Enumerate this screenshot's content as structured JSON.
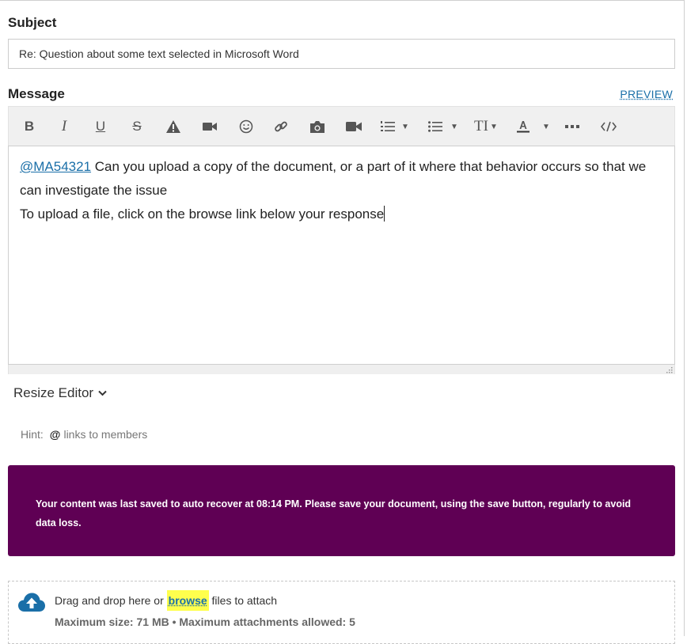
{
  "subject": {
    "label": "Subject",
    "value": "Re: Question about some text selected in Microsoft Word"
  },
  "message": {
    "label": "Message",
    "preview_label": "PREVIEW"
  },
  "toolbar": {
    "bold": "B",
    "italic": "I",
    "underline": "U",
    "strikethrough": "S",
    "font_size": "TI"
  },
  "editor": {
    "mention": "@MA54321",
    "line1_rest": " Can you upload a copy of the document, or a part of it where that behavior occurs so that we can investigate the issue",
    "line2": "To upload a file, click on the browse link below your response"
  },
  "resize_label": "Resize Editor",
  "hint": {
    "prefix": "Hint:",
    "symbol": "@",
    "text": "links to members"
  },
  "notice": {
    "text": "Your content was last saved to auto recover at 08:14 PM. Please save your document, using the save button, regularly to avoid data loss."
  },
  "attach": {
    "before": "Drag and drop here or ",
    "browse": "browse",
    "after": " files to attach",
    "limits": "Maximum size: 71 MB • Maximum attachments allowed: 5"
  },
  "colors": {
    "accent": "#1a6fa8",
    "notice_bg": "#5f0054",
    "highlight": "#ffff4d"
  }
}
